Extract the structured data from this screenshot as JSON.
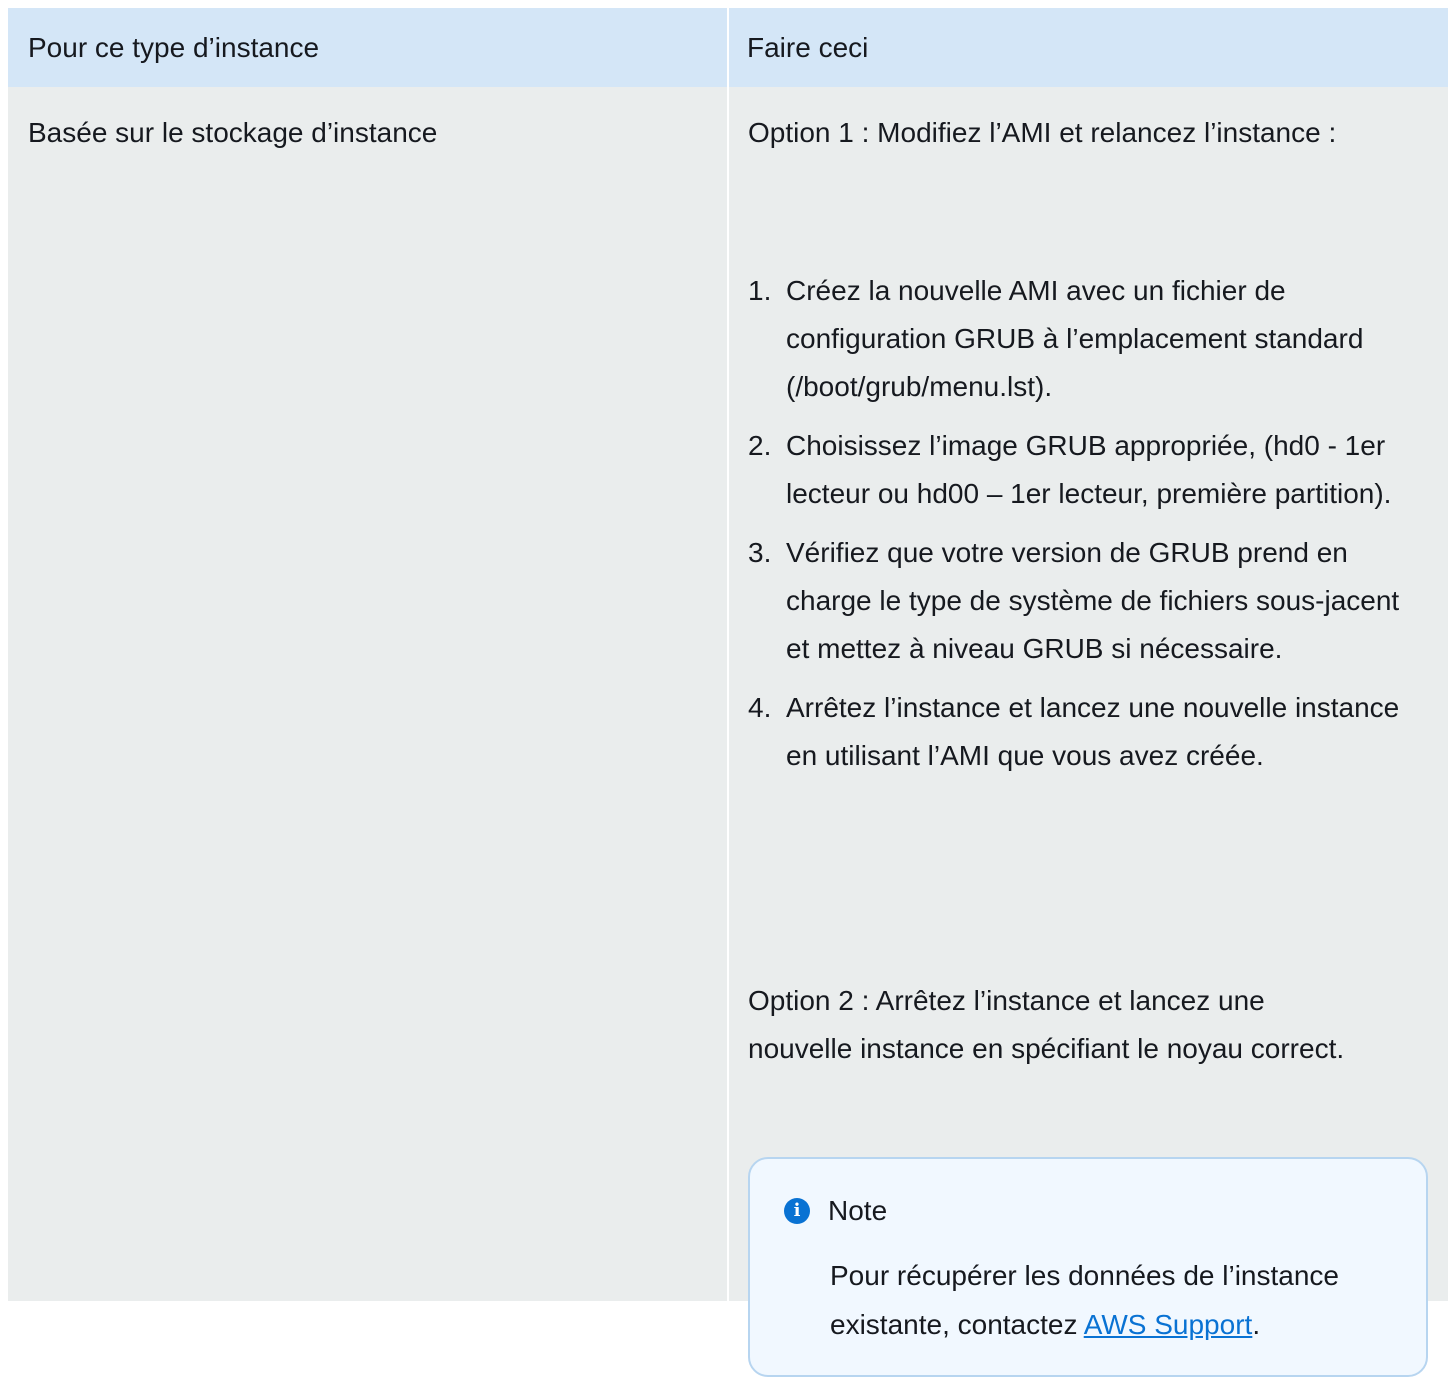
{
  "header": {
    "col1": "Pour ce type d’instance",
    "col2": "Faire ceci"
  },
  "row": {
    "instance_type": "Basée sur le stockage d’instance",
    "option1_intro": "Option 1 : Modifiez l’AMI et relancez l’instance :",
    "steps": [
      {
        "num": "1.",
        "text": "Créez la nouvelle AMI avec un fichier de configuration GRUB à l’emplacement standard (/boot/grub/menu.lst)."
      },
      {
        "num": "2.",
        "text": "Choisissez l’image GRUB appropriée, (hd0 - 1er lecteur ou hd00 – 1er lecteur, première partition)."
      },
      {
        "num": "3.",
        "text": "Vérifiez que votre version de GRUB prend en charge le type de système de fichiers sous-jacent et mettez à niveau GRUB si nécessaire."
      },
      {
        "num": "4.",
        "text": "Arrêtez l’instance et lancez une nouvelle instance en utilisant l’AMI que vous avez créée."
      }
    ],
    "option2": "Option 2 : Arrêtez l’instance et lancez une nouvelle instance en spécifiant le noyau correct.",
    "note": {
      "icon": "info-icon",
      "title": "Note",
      "body_before_link": "Pour récupérer les données de l’instance existante, contactez ",
      "link_text": "AWS Support",
      "body_after_link": "."
    }
  },
  "colors": {
    "header_bg": "#d4e6f7",
    "cell_bg": "#eaeded",
    "note_bg": "#f1f8ff",
    "note_border": "#b7d5f0",
    "link": "#0972d3"
  }
}
